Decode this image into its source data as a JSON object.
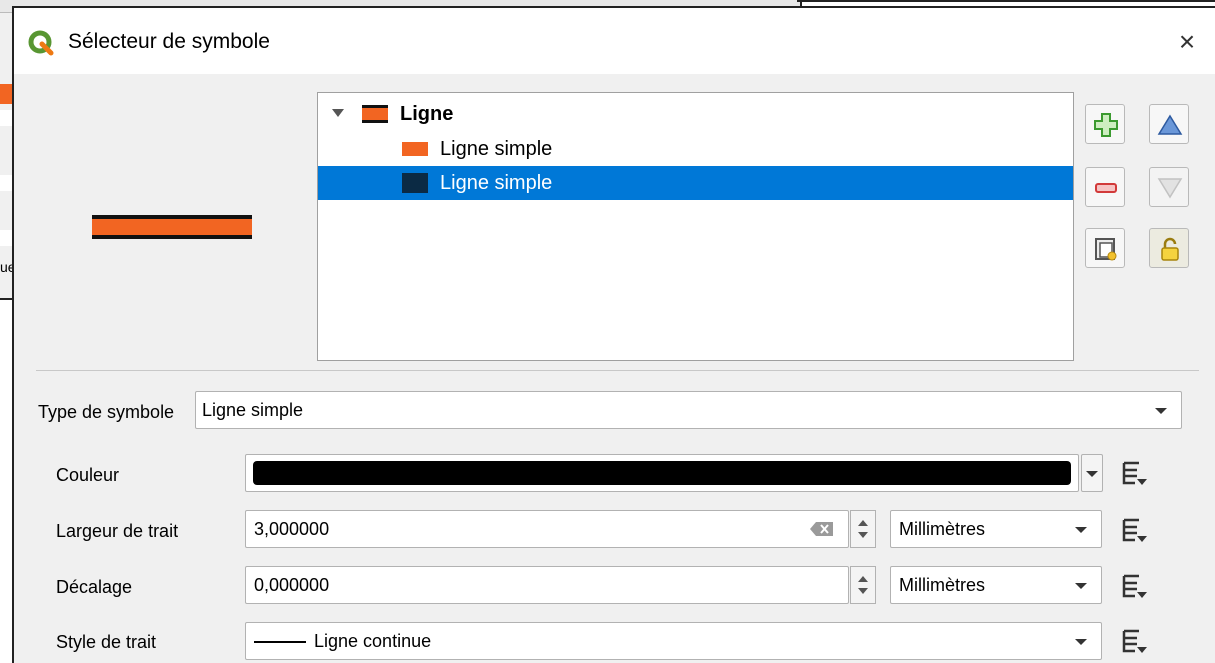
{
  "dialog": {
    "title": "Sélecteur de symbole",
    "close_glyph": "×"
  },
  "background": {
    "fragment_text": "ue",
    "accent_color": "#f26522"
  },
  "preview": {
    "fill_color": "#f26522",
    "stroke_color": "#111111"
  },
  "tree": {
    "root": {
      "label": "Ligne",
      "expanded": true
    },
    "layers": [
      {
        "label": "Ligne simple",
        "color": "#f26522",
        "selected": false
      },
      {
        "label": "Ligne simple",
        "color": "#0b2a44",
        "selected": true
      }
    ]
  },
  "side_buttons": [
    {
      "name": "add-layer",
      "icon": "plus-icon"
    },
    {
      "name": "move-up",
      "icon": "triangle-up-icon"
    },
    {
      "name": "remove-layer",
      "icon": "minus-icon"
    },
    {
      "name": "move-down",
      "icon": "triangle-down-icon",
      "disabled": true
    },
    {
      "name": "duplicate-layer",
      "icon": "duplicate-icon"
    },
    {
      "name": "lock-layer",
      "icon": "lock-icon"
    }
  ],
  "form": {
    "symbol_type": {
      "label": "Type de symbole",
      "value": "Ligne simple"
    },
    "color": {
      "label": "Couleur",
      "value": "#000000"
    },
    "stroke_width": {
      "label": "Largeur de trait",
      "value": "3,000000",
      "unit": "Millimètres"
    },
    "offset": {
      "label": "Décalage",
      "value": "0,000000",
      "unit": "Millimètres"
    },
    "stroke_style": {
      "label": "Style de trait",
      "value": "Ligne continue"
    }
  },
  "colors": {
    "selection": "#0078d7",
    "qgis_green": "#589632"
  }
}
